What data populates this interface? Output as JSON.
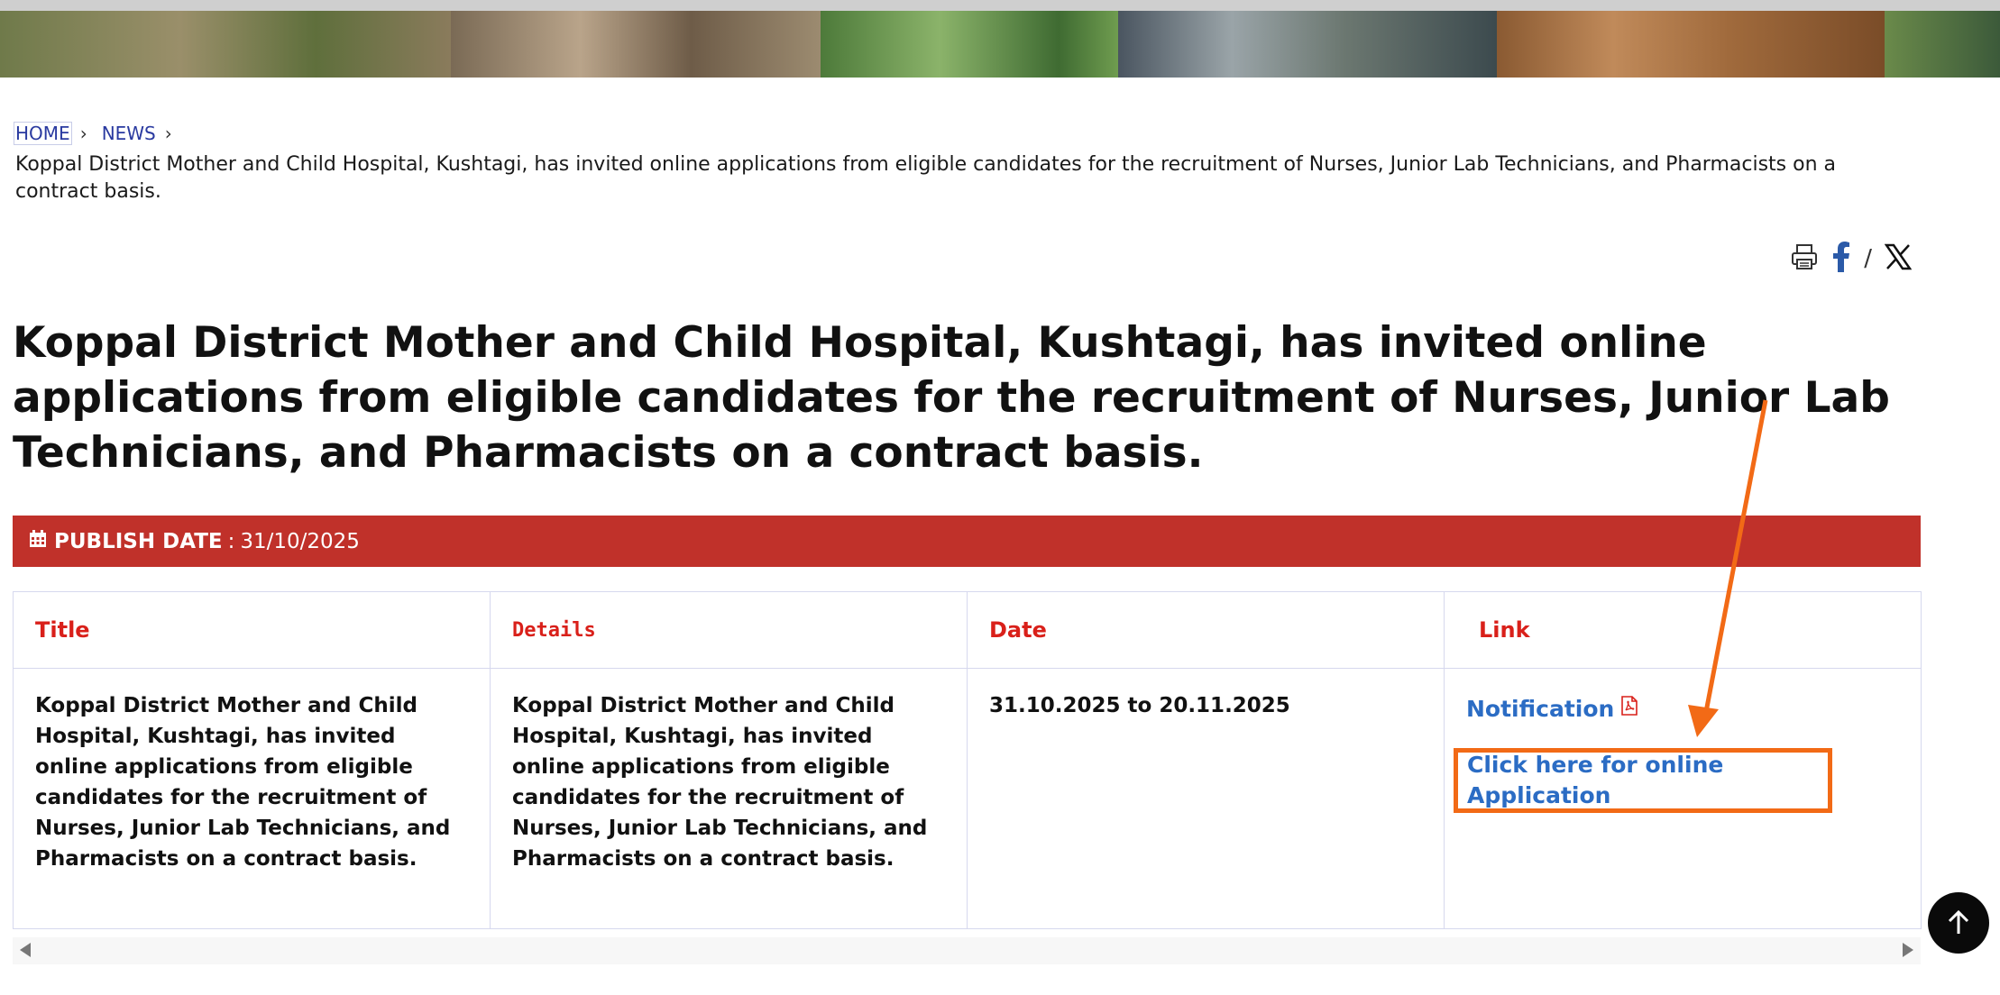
{
  "breadcrumb": {
    "home": "HOME",
    "news": "NEWS",
    "current": "Koppal District Mother and Child Hospital, Kushtagi, has invited online applications from eligible candidates for the recruitment of Nurses, Junior Lab Technicians, and Pharmacists on a contract basis."
  },
  "share": {
    "separator": "/",
    "icons": [
      "print-icon",
      "facebook-icon",
      "x-icon"
    ]
  },
  "article": {
    "title": "Koppal District Mother and Child Hospital, Kushtagi, has invited online applications from eligible candidates for the recruitment of Nurses, Junior Lab Technicians, and Pharmacists on a contract basis.",
    "publish_label": "PUBLISH DATE",
    "publish_sep": ":",
    "publish_date": "31/10/2025"
  },
  "table": {
    "headers": [
      "Title",
      "Details",
      "Date",
      "Link"
    ],
    "row": {
      "title": "Koppal District Mother and Child Hospital, Kushtagi, has invited online applications from eligible candidates for the recruitment of Nurses, Junior Lab Technicians, and Pharmacists on a contract basis.",
      "details": "Koppal District Mother and Child Hospital, Kushtagi, has invited online applications from eligible candidates for the recruitment of Nurses, Junior Lab Technicians, and Pharmacists on a contract basis.",
      "date": "31.10.2025  to 20.11.2025",
      "notification_link": "Notification",
      "apply_link": "Click here for online Application"
    }
  },
  "colors": {
    "publish_bar": "#c0312a",
    "header_text": "#d9201a",
    "link": "#2b6cc4",
    "highlight": "#f26a16"
  }
}
